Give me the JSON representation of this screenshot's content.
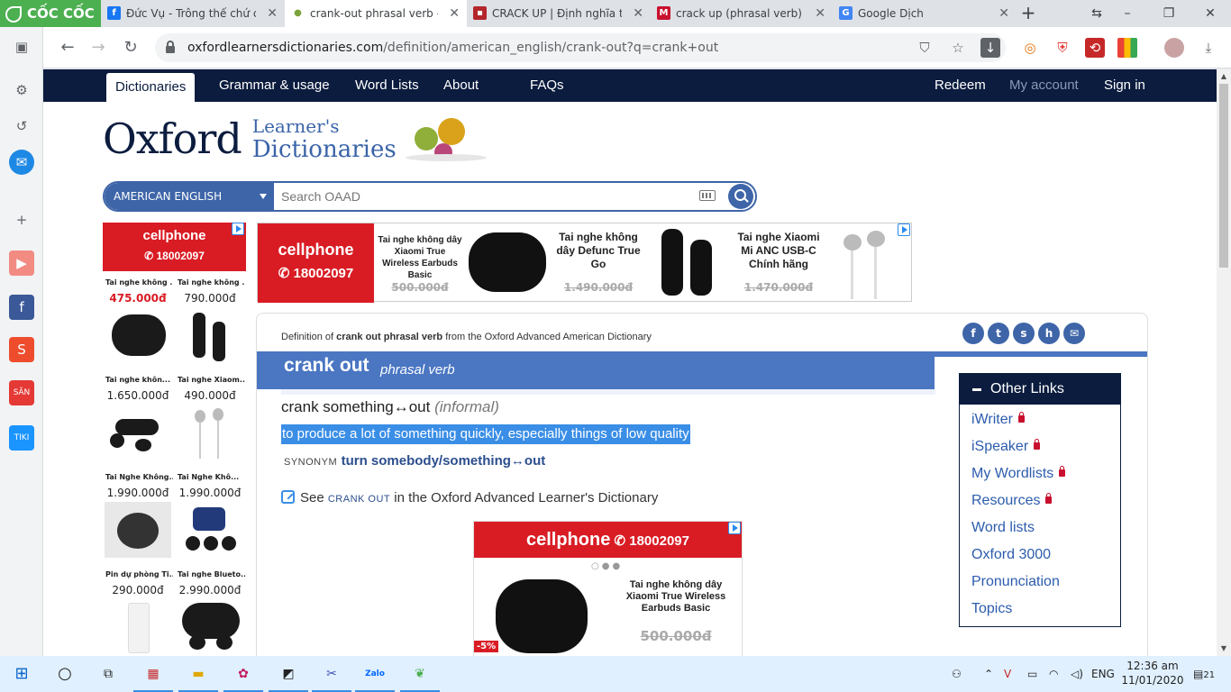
{
  "browser": {
    "brand": "CỐC CỐC",
    "tabs": [
      {
        "title": "Đức Vụ - Trông thế chứ có b",
        "favicon": "facebook-icon",
        "active": false
      },
      {
        "title": "crank-out phrasal verb - De",
        "favicon": "oxford-icon",
        "active": true
      },
      {
        "title": "CRACK UP | Định nghĩa tron",
        "favicon": "cambridge-icon",
        "active": false
      },
      {
        "title": "crack up (phrasal verb) defir",
        "favicon": "macmillan-icon",
        "active": false
      },
      {
        "title": "Google Dịch",
        "favicon": "google-translate-icon",
        "active": false
      }
    ],
    "url_host": "oxfordlearnersdictionaries.com",
    "url_path": "/definition/american_english/crank-out?q=crank+out"
  },
  "site_nav": {
    "left": [
      "Dictionaries",
      "Grammar & usage",
      "Word Lists",
      "About",
      "FAQs"
    ],
    "right": [
      "Redeem",
      "My account",
      "Sign in"
    ],
    "active": "Dictionaries"
  },
  "brand": {
    "name": "Oxford",
    "line1": "Learner's",
    "line2": "Dictionaries"
  },
  "search": {
    "dictionary": "AMERICAN ENGLISH",
    "placeholder": "Search OAAD"
  },
  "ads": {
    "brand": "cellphone",
    "hotline": "18002097",
    "left_items": [
      {
        "name": "Tai nghe không ...",
        "price": "475.000đ",
        "highlight": true
      },
      {
        "name": "Tai nghe không ...",
        "price": "790.000đ",
        "highlight": false
      },
      {
        "name": "Tai nghe khôn...",
        "price": "1.650.000đ",
        "highlight": false
      },
      {
        "name": "Tai nghe Xiaom...",
        "price": "490.000đ",
        "highlight": false
      },
      {
        "name": "Tai Nghe Không...",
        "price": "1.990.000đ",
        "highlight": false
      },
      {
        "name": "Tai Nghe Khô...",
        "price": "1.990.000đ",
        "highlight": false
      },
      {
        "name": "Pin dự phòng Ti...",
        "price": "290.000đ",
        "highlight": false
      },
      {
        "name": "Tai nghe Blueto...",
        "price": "2.990.000đ",
        "highlight": false
      }
    ],
    "top_items": [
      {
        "name": "Tai nghe không dây Xiaomi True Wireless Earbuds Basic",
        "old_price": "500.000đ"
      },
      {
        "name": "Tai nghe không dây Defunc True Go",
        "old_price": "1.490.000đ"
      },
      {
        "name": "Tai nghe Xiaomi Mi ANC USB-C Chính hãng",
        "old_price": "1.470.000đ"
      }
    ],
    "mid_item": {
      "name": "Tai nghe không dây Xiaomi True Wireless Earbuds Basic",
      "old_price": "500.000đ",
      "discount": "-5%"
    }
  },
  "entry": {
    "definition_of_prefix": "Definition of ",
    "definition_of_term": "crank out phrasal verb",
    "definition_of_suffix": " from the Oxford Advanced American Dictionary",
    "headword": "crank out",
    "pos": "phrasal verb",
    "sense_pattern": "crank something↔out",
    "sense_label": "(informal)",
    "definition": "to produce a lot of something quickly, especially things of low quality",
    "synonym_label": "SYNONYM",
    "synonym": "turn somebody/something↔out",
    "see_prefix": "See ",
    "see_term": "CRANK OUT",
    "see_suffix": " in the Oxford Advanced Learner's Dictionary"
  },
  "other_links": {
    "title": "Other Links",
    "items": [
      {
        "label": "iWriter",
        "locked": true
      },
      {
        "label": "iSpeaker",
        "locked": true
      },
      {
        "label": "My Wordlists",
        "locked": true
      },
      {
        "label": "Resources",
        "locked": true
      },
      {
        "label": "Word lists",
        "locked": false
      },
      {
        "label": "Oxford 3000",
        "locked": false
      },
      {
        "label": "Pronunciation",
        "locked": false
      },
      {
        "label": "Topics",
        "locked": false
      }
    ]
  },
  "taskbar": {
    "language": "ENG",
    "time": "12:36 am",
    "date": "11/01/2020",
    "notifications": "21"
  },
  "colors": {
    "oxford_navy": "#0b1c3e",
    "oxford_blue": "#4a76c2",
    "ad_red": "#d91c24",
    "highlight": "#3a8ee6"
  }
}
